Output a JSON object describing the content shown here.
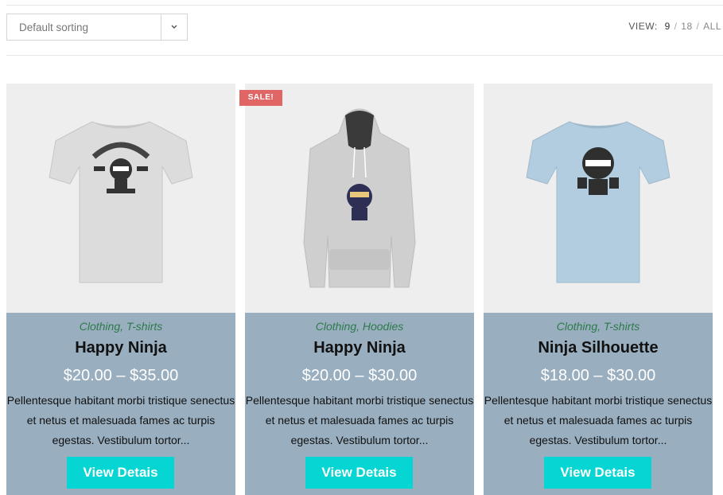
{
  "toolbar": {
    "sort": {
      "selected": "Default sorting",
      "icon": "chevron-down-icon"
    },
    "view": {
      "label": "VIEW:",
      "options": [
        "9",
        "18",
        "ALL"
      ],
      "active": "9"
    }
  },
  "products": [
    {
      "categories": "Clothing, T-shirts",
      "title": "Happy Ninja",
      "price": "$20.00 – $35.00",
      "description": "Pellentesque habitant morbi tristique senectus et netus et malesuada fames ac turpis egestas. Vestibulum tortor...",
      "button": "View Detais",
      "image": "white-tshirt-ninja"
    },
    {
      "badge": "SALE!",
      "categories": "Clothing, Hoodies",
      "title": "Happy Ninja",
      "price": "$20.00 – $30.00",
      "description": "Pellentesque habitant morbi tristique senectus et netus et malesuada fames ac turpis egestas. Vestibulum tortor...",
      "button": "View Detais",
      "image": "grey-hoodie-ninja"
    },
    {
      "categories": "Clothing, T-shirts",
      "title": "Ninja Silhouette",
      "price": "$18.00 – $30.00",
      "description": "Pellentesque habitant morbi tristique senectus et netus et malesuada fames ac turpis egestas. Vestibulum tortor...",
      "button": "View Detais",
      "image": "blue-tshirt-ninja"
    }
  ],
  "colors": {
    "card_body": "#99aebf",
    "button": "#06d6d3",
    "sale_badge": "#e06666",
    "category_text": "#2d7a4a"
  }
}
